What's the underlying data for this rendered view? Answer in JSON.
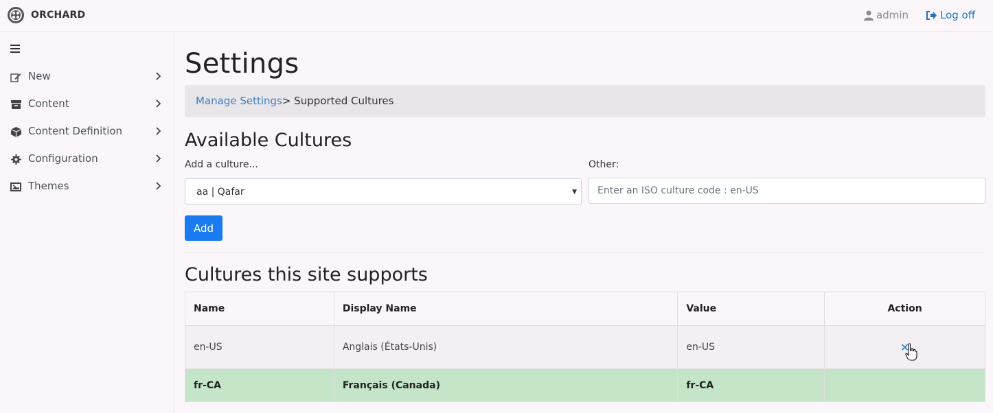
{
  "brand": {
    "name": "ORCHARD"
  },
  "user": {
    "name": "admin",
    "logoff_label": "Log off"
  },
  "sidebar": {
    "items": [
      {
        "label": "New",
        "icon": "edit-icon"
      },
      {
        "label": "Content",
        "icon": "archive-icon"
      },
      {
        "label": "Content Definition",
        "icon": "cube-icon"
      },
      {
        "label": "Configuration",
        "icon": "cog-icon"
      },
      {
        "label": "Themes",
        "icon": "image-icon"
      }
    ]
  },
  "page": {
    "title": "Settings"
  },
  "breadcrumb": {
    "link": "Manage Settings",
    "separator": ">",
    "current": " Supported Cultures"
  },
  "available": {
    "heading": "Available Cultures",
    "add_label": "Add a culture...",
    "selected_culture": "aa | Qafar",
    "other_label": "Other:",
    "other_placeholder": "Enter an ISO culture code : en-US",
    "add_button": "Add"
  },
  "supported": {
    "heading": "Cultures this site supports",
    "columns": [
      "Name",
      "Display Name",
      "Value",
      "Action"
    ],
    "rows": [
      {
        "name": "en-US",
        "display_name": "Anglais (États-Unis)",
        "value": "en-US",
        "has_delete": true,
        "is_default": false
      },
      {
        "name": "fr-CA",
        "display_name": "Français (Canada)",
        "value": "fr-CA",
        "has_delete": false,
        "is_default": true
      }
    ]
  },
  "colors": {
    "link": "#1b75d0",
    "primary_button": "#1a7cf0",
    "default_row": "#c5e5c9"
  }
}
